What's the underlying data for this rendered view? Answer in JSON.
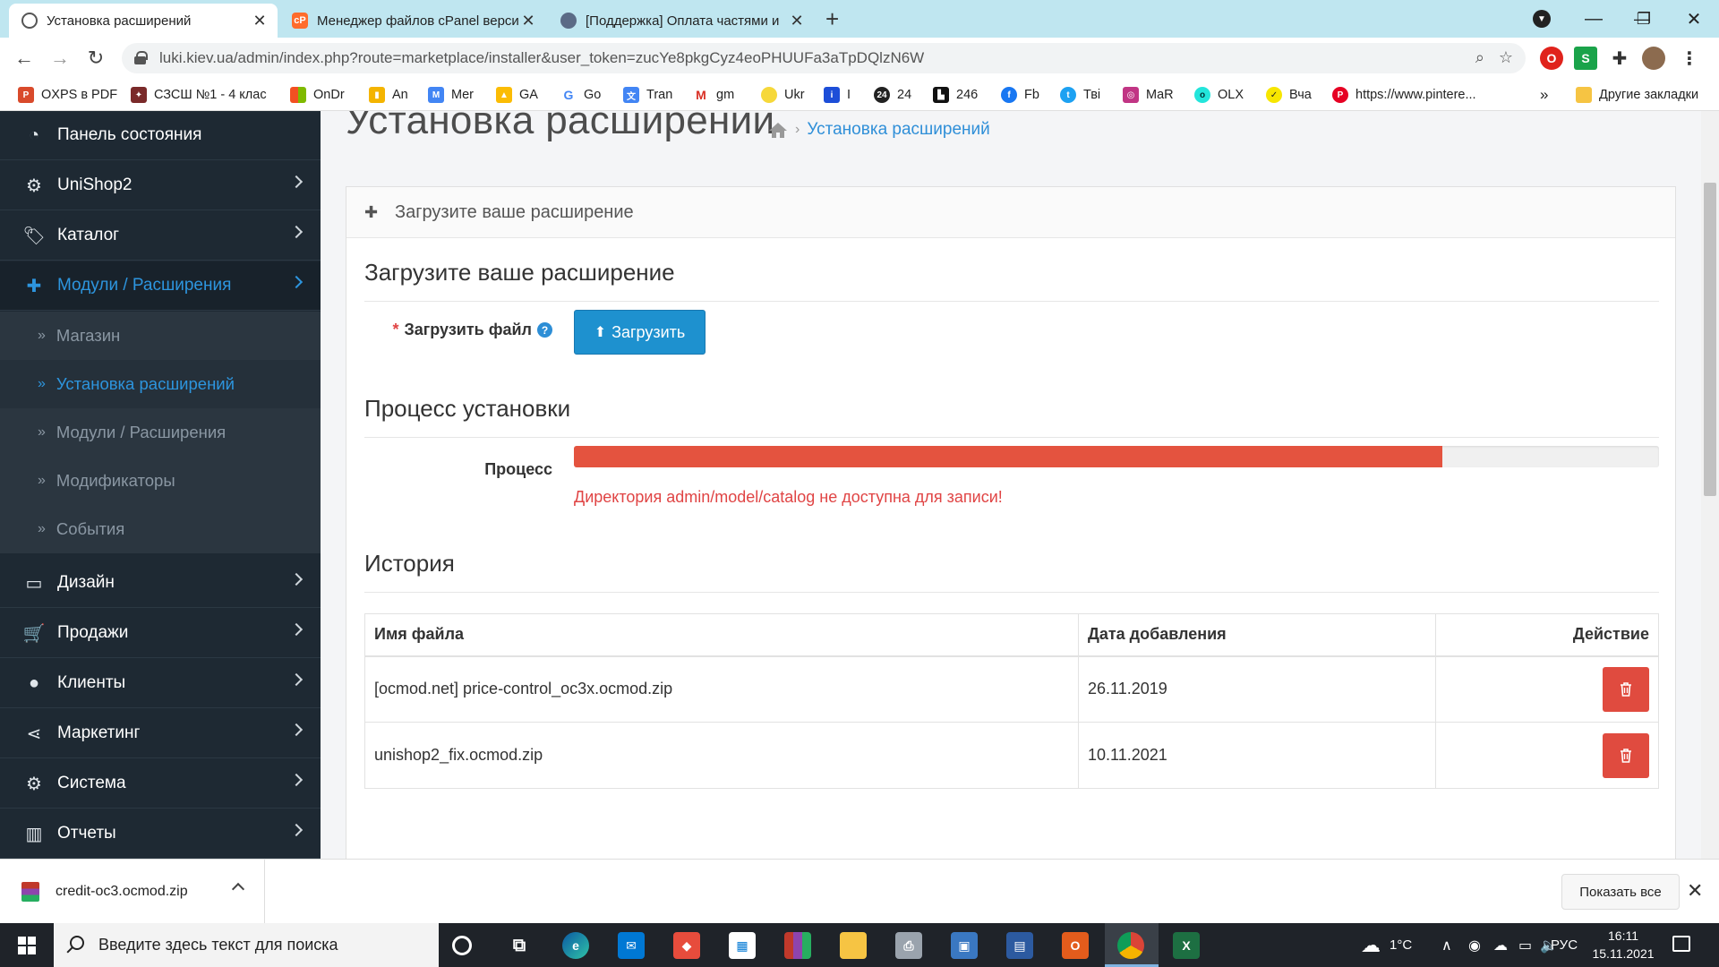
{
  "browser": {
    "tabs": [
      {
        "title": "Установка расширений",
        "active": true
      },
      {
        "title": "Менеджер файлов cPanel верси",
        "active": false
      },
      {
        "title": "[Поддержка] Оплата частями и",
        "active": false
      }
    ],
    "url": "luki.kiev.ua/admin/index.php?route=marketplace/installer&user_token=zucYe8pkgCyz4eoPHUUFa3aTpDQlzN6W",
    "bookmarks": [
      "OXPS в PDF",
      "СЗСШ №1 - 4 клас",
      "OnDr",
      "An",
      "Mer",
      "GA",
      "Go",
      "Tran",
      "gm",
      "Ukr",
      "I",
      "24",
      "246",
      "Fb",
      "Твi",
      "MaR",
      "OLX",
      "Вча",
      "https://www.pintere...",
      "»",
      "Другие закладки"
    ]
  },
  "sidebar": {
    "items": [
      {
        "label": "Панель состояния",
        "icon": "dashboard-icon",
        "chevron": false
      },
      {
        "label": "UniShop2",
        "icon": "cogs-icon",
        "chevron": true
      },
      {
        "label": "Каталог",
        "icon": "tags-icon",
        "chevron": true
      },
      {
        "label": "Модули / Расширения",
        "icon": "puzzle-icon",
        "chevron": true,
        "open": true
      }
    ],
    "subitems": [
      {
        "label": "Магазин",
        "active": false
      },
      {
        "label": "Установка расширений",
        "active": true
      },
      {
        "label": "Модули / Расширения",
        "active": false
      },
      {
        "label": "Модификаторы",
        "active": false
      },
      {
        "label": "События",
        "active": false
      }
    ],
    "items_after": [
      {
        "label": "Дизайн",
        "icon": "desktop-icon"
      },
      {
        "label": "Продажи",
        "icon": "cart-icon"
      },
      {
        "label": "Клиенты",
        "icon": "user-icon"
      },
      {
        "label": "Маркетинг",
        "icon": "share-icon"
      },
      {
        "label": "Система",
        "icon": "cog-icon"
      },
      {
        "label": "Отчеты",
        "icon": "bar-chart-icon"
      }
    ]
  },
  "main": {
    "page_title": "Установка расширений",
    "breadcrumb": "Установка расширений",
    "panel_heading": "Загрузите ваше расширение",
    "upload_section_title": "Загрузите ваше расширение",
    "file_label": "Загрузить файл",
    "required_mark": "*",
    "help_mark": "?",
    "upload_button": "Загрузить",
    "process_section_title": "Процесс установки",
    "process_label": "Процесс",
    "progress_percent": 80,
    "progress_color": "#e4533f",
    "error_text": "Директория admin/model/catalog не доступна для записи!",
    "history_title": "История",
    "history": {
      "columns": [
        "Имя файла",
        "Дата добавления",
        "Действие"
      ],
      "rows": [
        {
          "file": "[ocmod.net] price-control_oc3x.ocmod.zip",
          "date": "26.11.2019"
        },
        {
          "file": "unishop2_fix.ocmod.zip",
          "date": "10.11.2021"
        }
      ]
    }
  },
  "downloads": {
    "file": "credit-oc3.ocmod.zip",
    "show_all": "Показать все"
  },
  "taskbar": {
    "search_placeholder": "Введите здесь текст для поиска",
    "weather": "1°C",
    "lang": "РУС",
    "time": "16:11",
    "date": "15.11.2021"
  }
}
